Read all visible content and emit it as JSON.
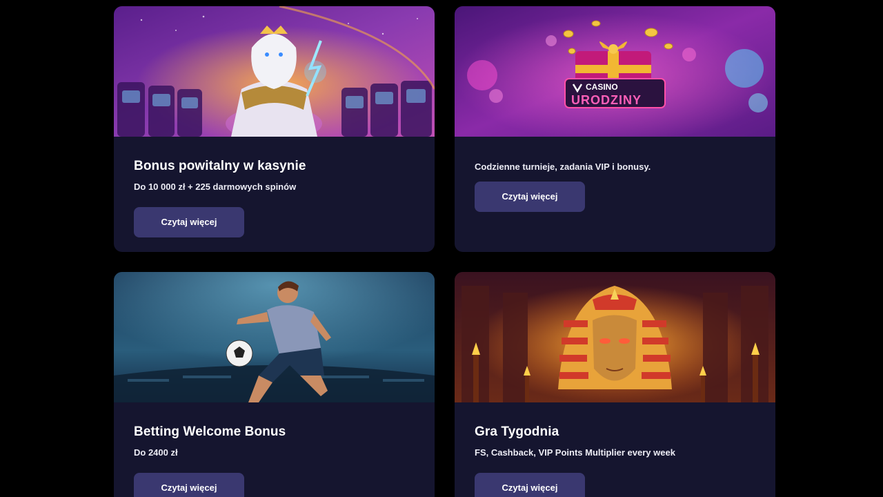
{
  "colors": {
    "page_bg": "#000000",
    "card_bg": "#15152f",
    "button_bg": "#3a3870",
    "text": "#ffffff"
  },
  "cards": [
    {
      "title": "Bonus powitalny w kasynie",
      "subtitle": "Do 10 000 zł + 225 darmowych spinów",
      "button_label": "Czytaj więcej",
      "image": "zeus-casino-banner"
    },
    {
      "title": "",
      "subtitle": "Codzienne turnieje, zadania VIP i bonusy.",
      "button_label": "Czytaj więcej",
      "image": "birthday-gift-banner",
      "logo": {
        "brand": "CASINO",
        "headline": "URODZINY"
      }
    },
    {
      "title": "Betting Welcome Bonus",
      "subtitle": "Do 2400 zł",
      "button_label": "Czytaj więcej",
      "image": "football-player-banner"
    },
    {
      "title": "Gra Tygodnia",
      "subtitle": "FS, Cashback, VIP Points Multiplier every week",
      "button_label": "Czytaj więcej",
      "image": "pharaoh-temple-banner"
    }
  ]
}
